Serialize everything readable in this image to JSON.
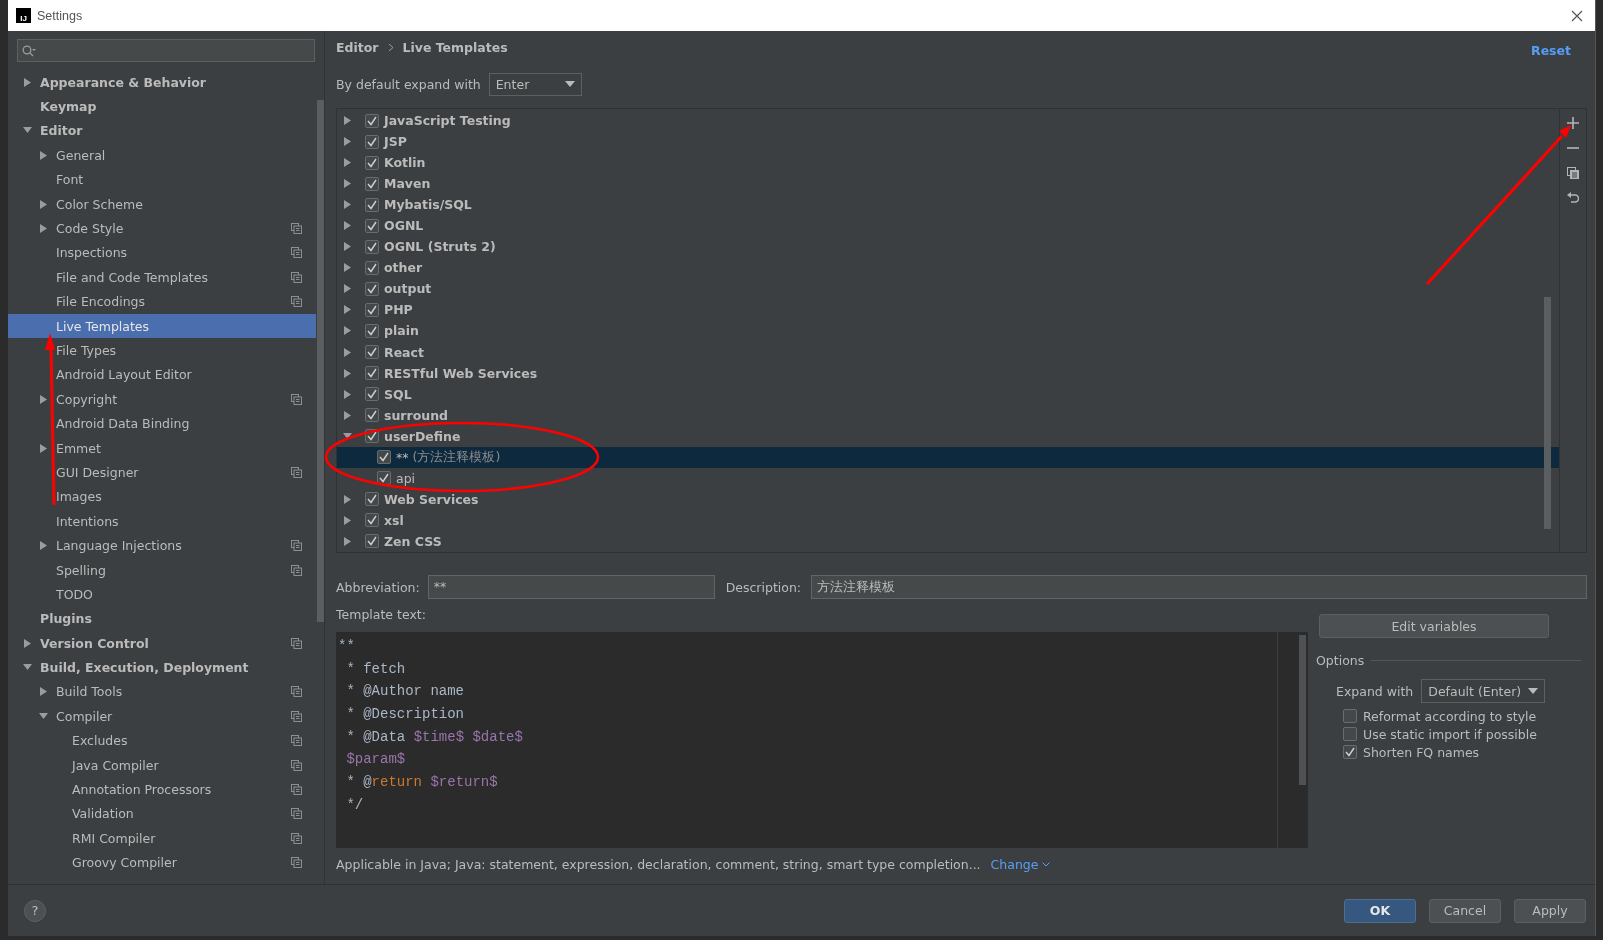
{
  "window": {
    "logo_text": "IJ",
    "title": "Settings"
  },
  "sidebar": {
    "items": [
      {
        "label": "Appearance & Behavior",
        "expanded": false,
        "selected": false,
        "project_level": false
      },
      {
        "label": "Keymap",
        "selected": false,
        "project_level": false
      },
      {
        "label": "Editor",
        "expanded": true,
        "selected": false,
        "project_level": false,
        "children": [
          {
            "label": "General",
            "expanded": false,
            "selected": false,
            "project_level": false
          },
          {
            "label": "Font",
            "selected": false,
            "project_level": false
          },
          {
            "label": "Color Scheme",
            "expanded": false,
            "selected": false,
            "project_level": false
          },
          {
            "label": "Code Style",
            "expanded": false,
            "selected": false,
            "project_level": true
          },
          {
            "label": "Inspections",
            "selected": false,
            "project_level": true
          },
          {
            "label": "File and Code Templates",
            "selected": false,
            "project_level": true
          },
          {
            "label": "File Encodings",
            "selected": false,
            "project_level": true
          },
          {
            "label": "Live Templates",
            "selected": true,
            "project_level": false
          },
          {
            "label": "File Types",
            "selected": false,
            "project_level": false
          },
          {
            "label": "Android Layout Editor",
            "selected": false,
            "project_level": false
          },
          {
            "label": "Copyright",
            "expanded": false,
            "selected": false,
            "project_level": true
          },
          {
            "label": "Android Data Binding",
            "selected": false,
            "project_level": false
          },
          {
            "label": "Emmet",
            "expanded": false,
            "selected": false,
            "project_level": false
          },
          {
            "label": "GUI Designer",
            "selected": false,
            "project_level": true
          },
          {
            "label": "Images",
            "selected": false,
            "project_level": false
          },
          {
            "label": "Intentions",
            "selected": false,
            "project_level": false
          },
          {
            "label": "Language Injections",
            "expanded": false,
            "selected": false,
            "project_level": true
          },
          {
            "label": "Spelling",
            "selected": false,
            "project_level": true
          },
          {
            "label": "TODO",
            "selected": false,
            "project_level": false
          }
        ]
      },
      {
        "label": "Plugins",
        "selected": false,
        "project_level": false
      },
      {
        "label": "Version Control",
        "expanded": false,
        "selected": false,
        "project_level": true
      },
      {
        "label": "Build, Execution, Deployment",
        "expanded": true,
        "selected": false,
        "project_level": false,
        "children": [
          {
            "label": "Build Tools",
            "expanded": false,
            "selected": false,
            "project_level": true
          },
          {
            "label": "Compiler",
            "expanded": true,
            "selected": false,
            "project_level": true,
            "children": [
              {
                "label": "Excludes",
                "selected": false,
                "project_level": true
              },
              {
                "label": "Java Compiler",
                "selected": false,
                "project_level": true
              },
              {
                "label": "Annotation Processors",
                "selected": false,
                "project_level": true
              },
              {
                "label": "Validation",
                "selected": false,
                "project_level": true
              },
              {
                "label": "RMI Compiler",
                "selected": false,
                "project_level": true
              },
              {
                "label": "Groovy Compiler",
                "selected": false,
                "project_level": true
              }
            ]
          }
        ]
      }
    ]
  },
  "breadcrumb": [
    "Editor",
    "Live Templates"
  ],
  "reset_link": "Reset",
  "expand_default": {
    "label": "By default expand with",
    "value": "Enter"
  },
  "template_groups": [
    {
      "name": "JavaScript Testing",
      "checked": true,
      "expanded": false,
      "selected": false
    },
    {
      "name": "JSP",
      "checked": true,
      "expanded": false,
      "selected": false
    },
    {
      "name": "Kotlin",
      "checked": true,
      "expanded": false,
      "selected": false
    },
    {
      "name": "Maven",
      "checked": true,
      "expanded": false,
      "selected": false
    },
    {
      "name": "Mybatis/SQL",
      "checked": true,
      "expanded": false,
      "selected": false
    },
    {
      "name": "OGNL",
      "checked": true,
      "expanded": false,
      "selected": false
    },
    {
      "name": "OGNL (Struts 2)",
      "checked": true,
      "expanded": false,
      "selected": false
    },
    {
      "name": "other",
      "checked": true,
      "expanded": false,
      "selected": false
    },
    {
      "name": "output",
      "checked": true,
      "expanded": false,
      "selected": false
    },
    {
      "name": "PHP",
      "checked": true,
      "expanded": false,
      "selected": false
    },
    {
      "name": "plain",
      "checked": true,
      "expanded": false,
      "selected": false
    },
    {
      "name": "React",
      "checked": true,
      "expanded": false,
      "selected": false
    },
    {
      "name": "RESTful Web Services",
      "checked": true,
      "expanded": false,
      "selected": false
    },
    {
      "name": "SQL",
      "checked": true,
      "expanded": false,
      "selected": false
    },
    {
      "name": "surround",
      "checked": true,
      "expanded": false,
      "selected": false
    },
    {
      "name": "userDefine",
      "checked": true,
      "expanded": true,
      "selected": false,
      "templates": [
        {
          "abbreviation": "**",
          "description": "(方法注释模板)",
          "checked": true,
          "selected": true
        },
        {
          "abbreviation": "api",
          "checked": true,
          "selected": false
        }
      ]
    },
    {
      "name": "Web Services",
      "checked": true,
      "expanded": false,
      "selected": false
    },
    {
      "name": "xsl",
      "checked": true,
      "expanded": false,
      "selected": false
    },
    {
      "name": "Zen CSS",
      "checked": true,
      "expanded": false,
      "selected": false
    }
  ],
  "abbreviation": {
    "label": "Abbreviation:",
    "value": "**"
  },
  "description": {
    "label": "Description:",
    "value": "方法注释模板"
  },
  "template_text": {
    "label": "Template text:",
    "lines": [
      [
        {
          "text": "**",
          "kind": "plain"
        }
      ],
      [
        {
          "text": " * fetch",
          "kind": "plain"
        }
      ],
      [
        {
          "text": " * @Author name",
          "kind": "plain"
        }
      ],
      [
        {
          "text": " * @Description",
          "kind": "plain"
        }
      ],
      [
        {
          "text": " * @Data ",
          "kind": "plain"
        },
        {
          "text": "$time$ $date$",
          "kind": "variable"
        }
      ],
      [
        {
          "text": " $param$",
          "kind": "variable"
        }
      ],
      [
        {
          "text": " * @",
          "kind": "plain"
        },
        {
          "text": "return",
          "kind": "keyword"
        },
        {
          "text": " $return$",
          "kind": "variable"
        }
      ],
      [
        {
          "text": " */",
          "kind": "plain"
        }
      ]
    ]
  },
  "edit_variables_button": "Edit variables",
  "options": {
    "title": "Options",
    "expand_with": {
      "label": "Expand with",
      "value": "Default (Enter)"
    },
    "checkboxes": [
      {
        "label": "Reformat according to style",
        "checked": false
      },
      {
        "label": "Use static import if possible",
        "checked": false
      },
      {
        "label": "Shorten FQ names",
        "checked": true
      }
    ]
  },
  "applicable": {
    "text": "Applicable in Java; Java: statement, expression, declaration, comment, string, smart type completion...",
    "link": "Change"
  },
  "help_button": "?",
  "buttons": [
    {
      "label": "OK",
      "kind": "primary"
    },
    {
      "label": "Cancel",
      "kind": "normal"
    },
    {
      "label": "Apply",
      "kind": "normal"
    }
  ]
}
